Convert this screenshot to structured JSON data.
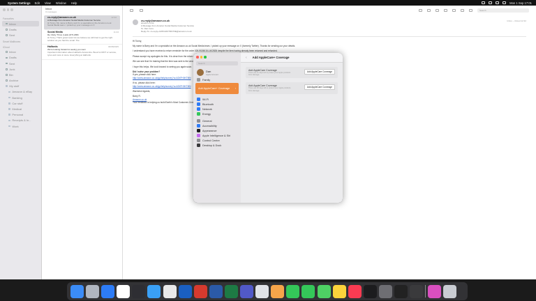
{
  "menubar": {
    "app": "System Settings",
    "menus": [
      "Edit",
      "View",
      "Window",
      "Help"
    ],
    "clock": "Mon 1 Sep  17:01"
  },
  "mail": {
    "sidebar": {
      "favourites_label": "Favourites",
      "favourites": [
        "Inbox",
        "Drafts",
        "Sent"
      ],
      "smart_label": "Smart Mailboxes",
      "icloud_label": "iCloud",
      "folders": [
        "Inbox",
        "Drafts",
        "Sent",
        "Junk",
        "Bin",
        "Archive",
        "My stuff",
        "Amazon & eBay",
        "Banking",
        "Car stuff",
        "Medical",
        "Personal",
        "Receipts & In...",
        "Work"
      ]
    },
    "list": {
      "title": "Inbox",
      "subtitle": "3 messages",
      "messages": [
        {
          "from": "cs-reply@amazon.co.uk",
          "date": "12:32",
          "subject": "A Message from Amazon Social Media Customer Service",
          "preview": "Hi Tonny, My name is Barry and I'm a specialist on the Amazon.co.uk Social Media team. I picked up your message on X"
        },
        {
          "from": "Social Media",
          "date": "11:24",
          "subject": "Re: Ruby Thrus       | Hello  (DTI-1884",
          "preview": "Hi Tonny, That's great news! As we believe we still tried to get the right solution as you had the email. The"
        },
        {
          "from": "Halfords",
          "date": "30/08/2025",
          "subject": "We're looking forward to seeing you soon",
          "preview": "Important information about Halfords Autocentre. Book for MOT or service, tyres and more in store. Everything at Halfords"
        }
      ]
    },
    "toolbar": {
      "search_placeholder": "Search"
    },
    "reader": {
      "from": "cs-reply@amazon.co.uk",
      "to_line": "amazon.co.uk",
      "subject": "A Message from Amazon Social Media Customer Service",
      "to": "To:  Dan Irons",
      "reply_to": "Reply-To:  cs-reply+A3XFH0KTMN73E@amazon.co.uk",
      "right": "Inbox – iCloud   12:32",
      "greeting": "Hi Tonny,",
      "p1": "My name is Barry and I'm a specialist on the Amazon.co.uk Social Media team. I picked up your message on X (formerly Twitter). Thanks for sending our your details.",
      "p2": "I understand you have received a return reminder for the order 026-9026015-1402826 despite the item having already been returned and refunded.",
      "p3": "Please accept my apologies for this. It is clear from the return information that the item has been received and the reminder was sent automatically.",
      "p4": "We can see that I'm training that the item was sent to the wrong address and import to you as a reminder from Halfords. I'm sorry and will request for the reminder to be removed.",
      "p5": "I hope this helps. We look forward to seeing you again soon.",
      "help1": "Did I solve your problem?",
      "help2": "If yes, please click here:",
      "link1": "http://www.amazon.co.uk/gp/help/survey?a=A3XFH0KTMN",
      "help3": "If no, please click here:",
      "link2": "http://www.amazon.co.uk/gp/help/survey?a=A3XFH0KTMN",
      "warm": "Warmest regards,",
      "sig1": "Barry R.",
      "sig2": "Amazon.co.uk",
      "sig3": "Your feedback is helping us build Earth's Most Customer-Centric Company."
    }
  },
  "settings": {
    "search_placeholder": "Search",
    "account_name": "Dan",
    "account_sub": "Apple Account",
    "family": "Family",
    "highlight": "Add AppleCare+ Coverage",
    "items": [
      "Wi-Fi",
      "Bluetooth",
      "Network",
      "Energy"
    ],
    "items2": [
      "General",
      "Accessibility",
      "Appearance",
      "Apple Intelligence & Siri",
      "Control Centre",
      "Desktop & Dock"
    ],
    "title": "Add AppleCare+ Coverage",
    "cards": [
      {
        "title": "Add AppleCare Coverage",
        "desc": "There are 11 days left to protect your Apple products from damage.",
        "button": "Add AppleCare Coverage"
      },
      {
        "title": "Add AppleCare Coverage",
        "desc": "There are 20 days left to protect your Apple products from damage.",
        "button": "Add AppleCare Coverage"
      }
    ]
  },
  "colors": {
    "accent": "#ef8a3c",
    "menubar": "#121212",
    "link": "#2a62c9"
  }
}
